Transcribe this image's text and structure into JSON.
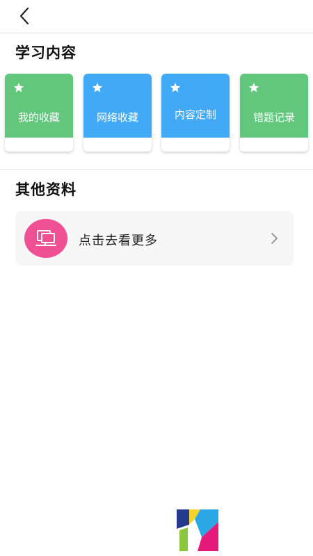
{
  "colors": {
    "green": "#62c77d",
    "blue": "#41a9f6",
    "pink": "#ef4f93"
  },
  "header": {
    "back_icon": "chevron-left-icon"
  },
  "study_section": {
    "title": "学习内容",
    "cards": [
      {
        "label": "我的收藏",
        "color": "#62c77d",
        "icon": "star-icon"
      },
      {
        "label": "网络收藏",
        "color": "#41a9f6",
        "icon": "star-icon"
      },
      {
        "label": "内容定制",
        "color": "#41a9f6",
        "icon": "star-icon"
      },
      {
        "label": "错题记录",
        "color": "#62c77d",
        "icon": "star-icon"
      }
    ]
  },
  "other_section": {
    "title": "其他资料",
    "more_item": {
      "label": "点击去看更多",
      "icon": "laptop-icon",
      "arrow_icon": "chevron-right-icon"
    }
  },
  "footer": {
    "logo": "app-logo"
  }
}
